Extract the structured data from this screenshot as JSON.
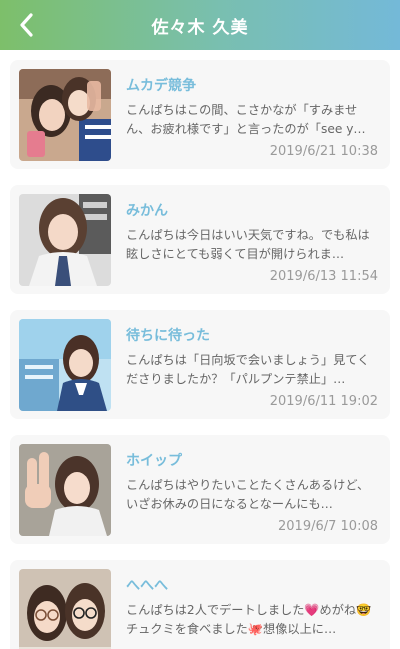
{
  "header": {
    "title": "佐々木 久美"
  },
  "entries": [
    {
      "title": "ムカデ競争",
      "snippet": "こんぱちはこの間、こさかなが「すみません、お疲れ様です」と言ったのが「see y…",
      "date": "2019/6/21 10:38"
    },
    {
      "title": "みかん",
      "snippet": "こんぱちは今日はいい天気ですね。でも私は眩しさにとても弱くて目が開けられま…",
      "date": "2019/6/13 11:54"
    },
    {
      "title": "待ちに待った",
      "snippet": "こんぱちは「日向坂で会いましょう」見てくださりましたか？「パルプンテ禁止」…",
      "date": "2019/6/11 19:02"
    },
    {
      "title": "ホイップ",
      "snippet": "こんぱちはやりたいことたくさんあるけど、いざお休みの日になるとなーんにも…",
      "date": "2019/6/7 10:08"
    },
    {
      "title": "へへへ",
      "snippet": "こんぱちは2人でデートしました💗めがね🤓チュクミを食べました🐙想像以上に…",
      "date": ""
    }
  ]
}
